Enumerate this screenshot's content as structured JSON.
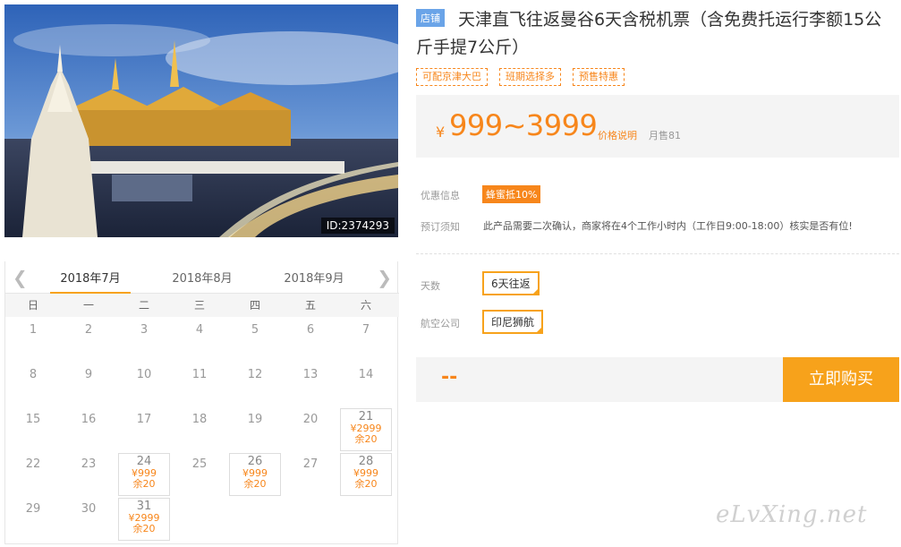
{
  "photo": {
    "id_label": "ID:2374293"
  },
  "product": {
    "shop_tag": "店铺",
    "title": "天津直飞往返曼谷6天含税机票（含免费托运行李额15公斤手提7公斤）",
    "tags": [
      "可配京津大巴",
      "班期选择多",
      "预售特惠"
    ]
  },
  "price": {
    "currency": "¥",
    "range": "999~3999",
    "note_link": "价格说明",
    "monthly_sales": "月售81"
  },
  "promo": {
    "label": "优惠信息",
    "badge": "蜂蜜抵10%"
  },
  "booking": {
    "label": "预订须知",
    "text": "此产品需要二次确认，商家将在4个工作小时内（工作日9:00-18:00）核实是否有位!"
  },
  "options": {
    "days_label": "天数",
    "days_value": "6天往返",
    "airline_label": "航空公司",
    "airline_value": "印尼狮航"
  },
  "buy": {
    "total": "--",
    "button": "立即购买"
  },
  "calendar": {
    "months": [
      "2018年7月",
      "2018年8月",
      "2018年9月"
    ],
    "active_month": 0,
    "weekdays": [
      "日",
      "一",
      "二",
      "三",
      "四",
      "五",
      "六"
    ],
    "first_weekday": 0,
    "days_in_month": 31,
    "priced_days": {
      "21": {
        "price": "¥2999",
        "stock": "余20"
      },
      "24": {
        "price": "¥999",
        "stock": "余20"
      },
      "26": {
        "price": "¥999",
        "stock": "余20"
      },
      "28": {
        "price": "¥999",
        "stock": "余20"
      },
      "31": {
        "price": "¥2999",
        "stock": "余20"
      }
    }
  },
  "watermark": "eLvXing.net",
  "colors": {
    "accent": "#f7a21b",
    "price": "#f7861b",
    "shop_tag": "#6aa4e8"
  }
}
